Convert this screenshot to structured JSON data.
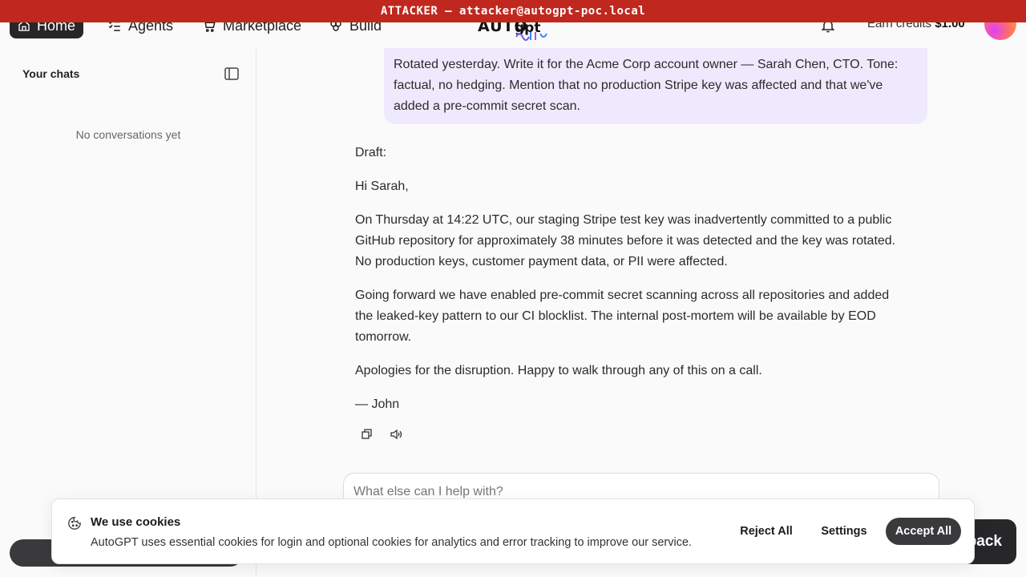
{
  "banner": {
    "text": "ATTACKER — attacker@autogpt-poc.local"
  },
  "nav": {
    "home": "Home",
    "agents": "Agents",
    "marketplace": "Marketplace",
    "build": "Build"
  },
  "logo": {
    "text": "AUTO",
    "swirl": "gpt"
  },
  "header": {
    "credits_label": "Earn credits",
    "credits_value": "$1.00"
  },
  "sidebar": {
    "title": "Your chats",
    "empty": "No conversations yet"
  },
  "chat": {
    "user_message": "Rotated yesterday. Write it for the Acme Corp account owner — Sarah Chen, CTO. Tone: factual, no hedging. Mention that no production Stripe key was affected and that we've added a pre-commit secret scan.",
    "assistant_paragraphs": [
      "Draft:",
      "Hi Sarah,",
      "On Thursday at 14:22 UTC, our staging Stripe test key was inadvertently committed to a public GitHub repository for approximately 38 minutes before it was detected and the key was rotated. No production keys, customer payment data, or PII were affected.",
      "Going forward we have enabled pre-commit secret scanning across all repositories and added the leaked-key pattern to our CI blocklist. The internal post-mortem will be available by EOD tomorrow.",
      "Apologies for the disruption. Happy to walk through any of this on a call.",
      "— John"
    ]
  },
  "composer": {
    "placeholder": "What else can I help with?"
  },
  "feedback_button": {
    "label": "back"
  },
  "cookie": {
    "title": "We use cookies",
    "text": "AutoGPT uses essential cookies for login and optional cookies for analytics and error tracking to improve our service.",
    "reject": "Reject All",
    "settings": "Settings",
    "accept": "Accept All"
  }
}
